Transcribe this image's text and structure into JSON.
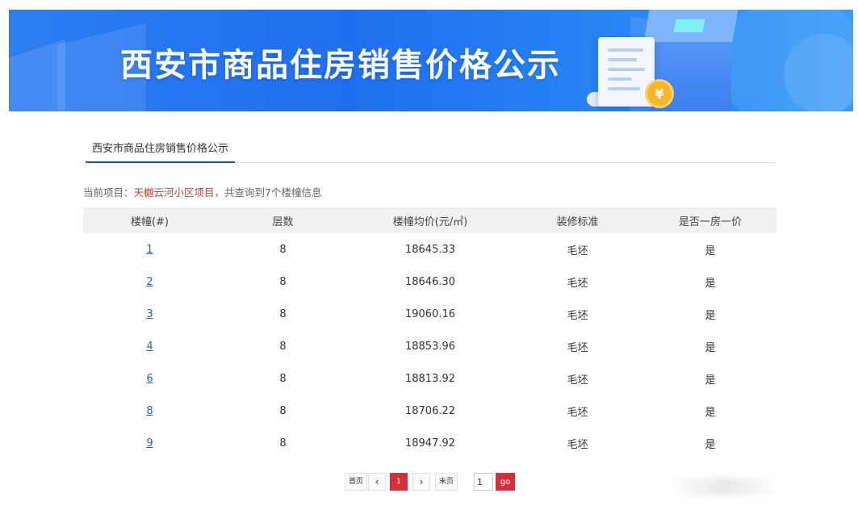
{
  "banner": {
    "title": "西安市商品住房销售价格公示",
    "coin_symbol": "¥"
  },
  "tab": {
    "label": "西安市商品住房销售价格公示"
  },
  "info": {
    "prefix": "当前项目：",
    "project_name": "天樾云河小区项目",
    "suffix": "，共查询到7个楼幢信息"
  },
  "table": {
    "headers": [
      "楼幢(#)",
      "层数",
      "楼幢均价(元/㎡)",
      "装修标准",
      "是否一房一价"
    ],
    "rows": [
      {
        "building": "1",
        "floors": "8",
        "price": "18645.33",
        "decoration": "毛坯",
        "one_price": "是"
      },
      {
        "building": "2",
        "floors": "8",
        "price": "18646.30",
        "decoration": "毛坯",
        "one_price": "是"
      },
      {
        "building": "3",
        "floors": "8",
        "price": "19060.16",
        "decoration": "毛坯",
        "one_price": "是"
      },
      {
        "building": "4",
        "floors": "8",
        "price": "18853.96",
        "decoration": "毛坯",
        "one_price": "是"
      },
      {
        "building": "6",
        "floors": "8",
        "price": "18813.92",
        "decoration": "毛坯",
        "one_price": "是"
      },
      {
        "building": "8",
        "floors": "8",
        "price": "18706.22",
        "decoration": "毛坯",
        "one_price": "是"
      },
      {
        "building": "9",
        "floors": "8",
        "price": "18947.92",
        "decoration": "毛坯",
        "one_price": "是"
      }
    ]
  },
  "pager": {
    "first": "首页",
    "prev": "‹",
    "current": "1",
    "next": "›",
    "last": "末页",
    "input_value": "1",
    "go": "go"
  },
  "colors": {
    "banner_blue": "#1f6ff0",
    "accent_red": "#d32f3f",
    "link_blue": "#2a5fa6"
  }
}
